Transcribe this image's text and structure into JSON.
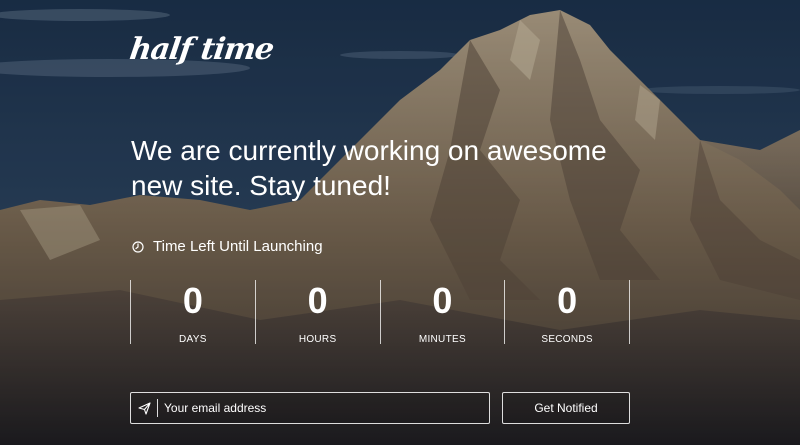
{
  "brand": {
    "logo_text": "half time"
  },
  "hero": {
    "headline": "We are currently working on awesome new site. Stay tuned!"
  },
  "countdown": {
    "label": "Time Left Until Launching",
    "icon": "clock-icon",
    "units": [
      {
        "value": "0",
        "label": "DAYS"
      },
      {
        "value": "0",
        "label": "HOURS"
      },
      {
        "value": "0",
        "label": "MINUTES"
      },
      {
        "value": "0",
        "label": "SECONDS"
      }
    ]
  },
  "subscribe": {
    "icon": "send-icon",
    "email_placeholder": "Your email address",
    "email_value": "",
    "button_label": "Get Notified"
  },
  "colors": {
    "text": "#ffffff",
    "sky": "#2c4560",
    "rock": "#7a6a55"
  }
}
